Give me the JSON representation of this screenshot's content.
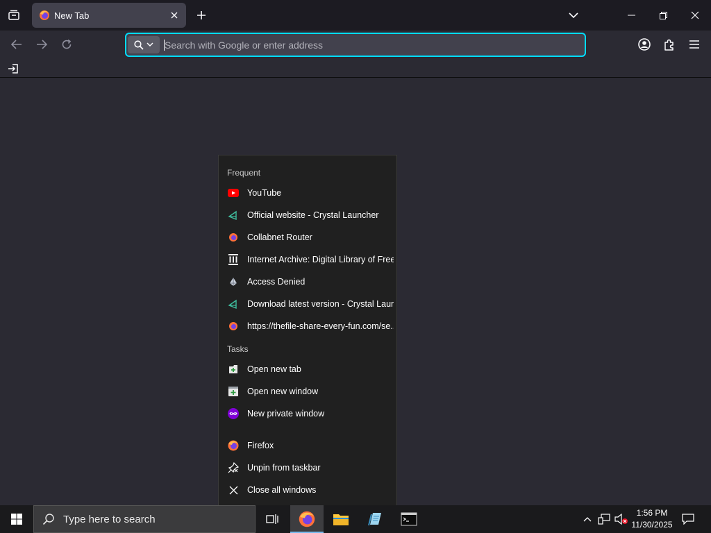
{
  "colors": {
    "accent": "#00ddff",
    "toolbar": "#2b2a33",
    "tabstrip": "#1c1b22",
    "jumplist": "#202020"
  },
  "browser": {
    "tab": {
      "title": "New Tab",
      "favicon": "firefox-icon"
    },
    "urlbar": {
      "placeholder": "Search with Google or enter address",
      "value": ""
    }
  },
  "jumplist": {
    "frequent_header": "Frequent",
    "frequent": [
      {
        "label": "YouTube",
        "icon": "youtube-icon"
      },
      {
        "label": "Official website - Crystal Launcher",
        "icon": "crystal-launcher-icon"
      },
      {
        "label": "Collabnet Router",
        "icon": "firefox-page-icon"
      },
      {
        "label": "Internet Archive: Digital Library of Free...",
        "icon": "internet-archive-icon"
      },
      {
        "label": "Access Denied",
        "icon": "access-denied-icon"
      },
      {
        "label": "Download latest version - Crystal Laun...",
        "icon": "crystal-launcher-icon"
      },
      {
        "label": "https://thefile-share-every-fun.com/se...",
        "icon": "firefox-page-icon"
      }
    ],
    "tasks_header": "Tasks",
    "tasks": [
      {
        "label": "Open new tab",
        "icon": "new-tab-icon"
      },
      {
        "label": "Open new window",
        "icon": "new-window-icon"
      },
      {
        "label": "New private window",
        "icon": "private-window-icon"
      }
    ],
    "app": [
      {
        "label": "Firefox",
        "icon": "firefox-icon"
      },
      {
        "label": "Unpin from taskbar",
        "icon": "unpin-icon"
      },
      {
        "label": "Close all windows",
        "icon": "close-icon"
      }
    ]
  },
  "taskbar": {
    "search_placeholder": "Type here to search",
    "time": "1:56 PM",
    "date": "11/30/2025"
  }
}
